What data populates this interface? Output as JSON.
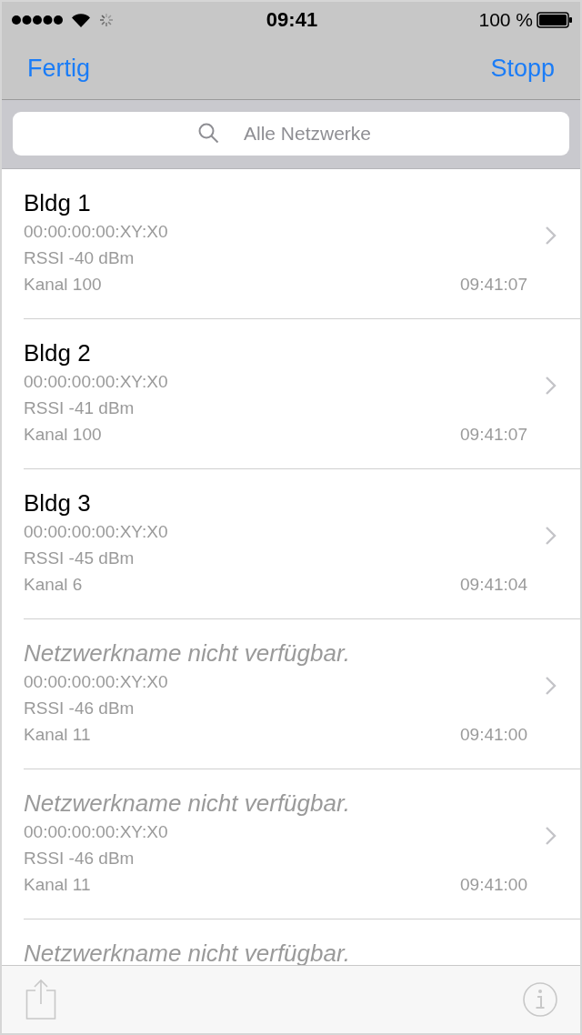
{
  "status_bar": {
    "time": "09:41",
    "battery": "100 %"
  },
  "nav": {
    "left_button": "Fertig",
    "right_button": "Stopp"
  },
  "search": {
    "placeholder": "Alle Netzwerke"
  },
  "networks": [
    {
      "kind": "named",
      "name": "Bldg 1",
      "mac": "00:00:00:00:XY:X0",
      "rssi": "RSSI -40 dBm",
      "channel": "Kanal 100",
      "time": "09:41:07"
    },
    {
      "kind": "named",
      "name": "Bldg 2",
      "mac": "00:00:00:00:XY:X0",
      "rssi": "RSSI -41 dBm",
      "channel": "Kanal 100",
      "time": "09:41:07"
    },
    {
      "kind": "named",
      "name": "Bldg 3",
      "mac": "00:00:00:00:XY:X0",
      "rssi": "RSSI -45 dBm",
      "channel": "Kanal 6",
      "time": "09:41:04"
    },
    {
      "kind": "unavailable",
      "name": "Netzwerkname nicht verfügbar.",
      "mac": "00:00:00:00:XY:X0",
      "rssi": "RSSI -46 dBm",
      "channel": "Kanal 11",
      "time": "09:41:00"
    },
    {
      "kind": "unavailable",
      "name": "Netzwerkname nicht verfügbar.",
      "mac": "00:00:00:00:XY:X0",
      "rssi": "RSSI -46 dBm",
      "channel": "Kanal 11",
      "time": "09:41:00"
    },
    {
      "kind": "unavailable",
      "name": "Netzwerkname nicht verfügbar."
    }
  ],
  "toolbar": {
    "disabled": true
  }
}
